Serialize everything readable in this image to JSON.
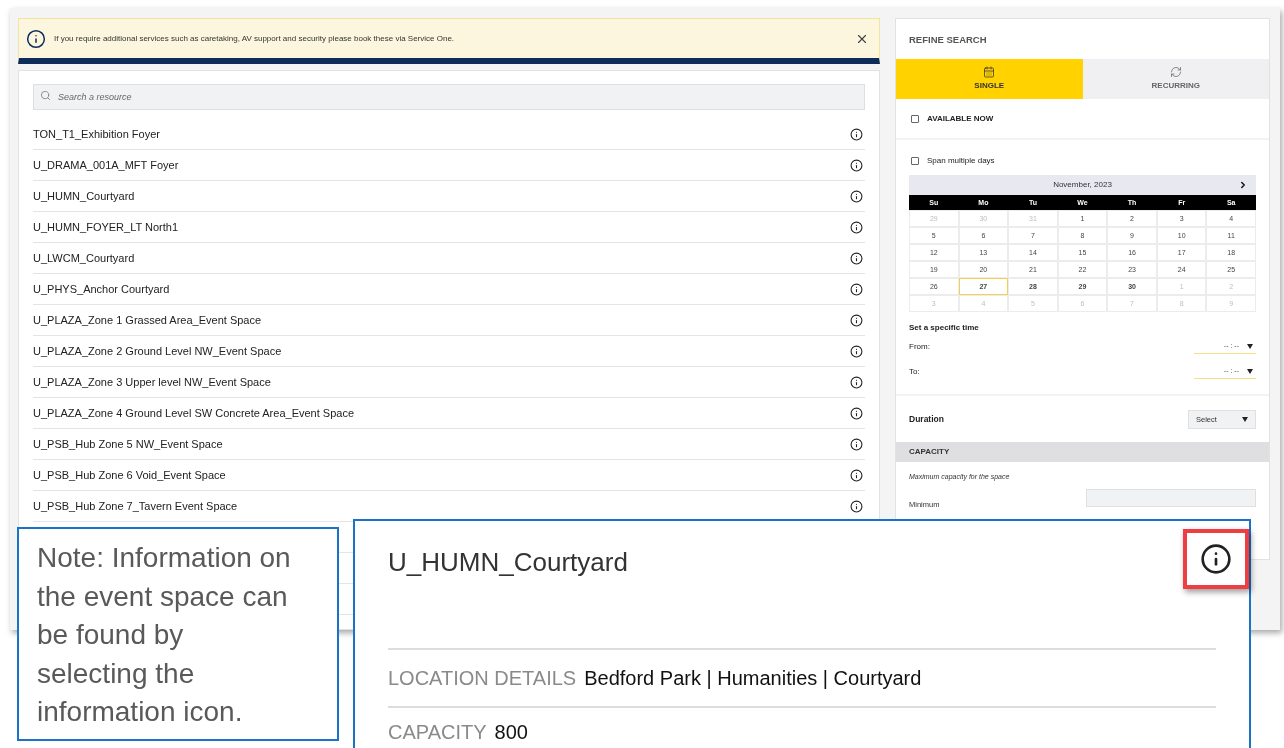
{
  "banner": {
    "message": "If you require additional services such as caretaking, AV support and security please book these via Service One."
  },
  "search": {
    "placeholder": "Search a resource"
  },
  "resources": [
    {
      "name": "TON_T1_Exhibition Foyer"
    },
    {
      "name": "U_DRAMA_001A_MFT Foyer"
    },
    {
      "name": "U_HUMN_Courtyard"
    },
    {
      "name": "U_HUMN_FOYER_LT North1"
    },
    {
      "name": "U_LWCM_Courtyard"
    },
    {
      "name": "U_PHYS_Anchor Courtyard"
    },
    {
      "name": "U_PLAZA_Zone 1 Grassed Area_Event Space"
    },
    {
      "name": "U_PLAZA_Zone 2 Ground Level NW_Event Space"
    },
    {
      "name": "U_PLAZA_Zone 3 Upper level NW_Event Space"
    },
    {
      "name": "U_PLAZA_Zone 4 Ground Level SW Concrete Area_Event Space"
    },
    {
      "name": "U_PSB_Hub Zone 5 NW_Event Space"
    },
    {
      "name": "U_PSB_Hub Zone 6 Void_Event Space"
    },
    {
      "name": "U_PSB_Hub Zone 7_Tavern Event Space"
    }
  ],
  "refine": {
    "title": "REFINE SEARCH",
    "tabs": [
      {
        "label": "SINGLE",
        "selected": true,
        "kind": "calendar"
      },
      {
        "label": "RECURRING",
        "selected": false,
        "kind": "recurring"
      }
    ],
    "available_now": {
      "label": "AVAILABLE NOW",
      "checked": false
    },
    "span_multiple_days": {
      "label": "Span multiple days",
      "checked": false
    },
    "calendar": {
      "month": "November, 2023",
      "weekdays": [
        "Su",
        "Mo",
        "Tu",
        "We",
        "Th",
        "Fr",
        "Sa"
      ],
      "weeks": [
        [
          {
            "d": "29",
            "muted": true,
            "bold": false,
            "selected": false
          },
          {
            "d": "30",
            "muted": true,
            "bold": false,
            "selected": false
          },
          {
            "d": "31",
            "muted": true,
            "bold": false,
            "selected": false
          },
          {
            "d": "1",
            "muted": false,
            "bold": false,
            "selected": false
          },
          {
            "d": "2",
            "muted": false,
            "bold": false,
            "selected": false
          },
          {
            "d": "3",
            "muted": false,
            "bold": false,
            "selected": false
          },
          {
            "d": "4",
            "muted": false,
            "bold": false,
            "selected": false
          }
        ],
        [
          {
            "d": "5",
            "muted": false,
            "bold": false,
            "selected": false
          },
          {
            "d": "6",
            "muted": false,
            "bold": false,
            "selected": false
          },
          {
            "d": "7",
            "muted": false,
            "bold": false,
            "selected": false
          },
          {
            "d": "8",
            "muted": false,
            "bold": false,
            "selected": false
          },
          {
            "d": "9",
            "muted": false,
            "bold": false,
            "selected": false
          },
          {
            "d": "10",
            "muted": false,
            "bold": false,
            "selected": false
          },
          {
            "d": "11",
            "muted": false,
            "bold": false,
            "selected": false
          }
        ],
        [
          {
            "d": "12",
            "muted": false,
            "bold": false,
            "selected": false
          },
          {
            "d": "13",
            "muted": false,
            "bold": false,
            "selected": false
          },
          {
            "d": "14",
            "muted": false,
            "bold": false,
            "selected": false
          },
          {
            "d": "15",
            "muted": false,
            "bold": false,
            "selected": false
          },
          {
            "d": "16",
            "muted": false,
            "bold": false,
            "selected": false
          },
          {
            "d": "17",
            "muted": false,
            "bold": false,
            "selected": false
          },
          {
            "d": "18",
            "muted": false,
            "bold": false,
            "selected": false
          }
        ],
        [
          {
            "d": "19",
            "muted": false,
            "bold": false,
            "selected": false
          },
          {
            "d": "20",
            "muted": false,
            "bold": false,
            "selected": false
          },
          {
            "d": "21",
            "muted": false,
            "bold": false,
            "selected": false
          },
          {
            "d": "22",
            "muted": false,
            "bold": false,
            "selected": false
          },
          {
            "d": "23",
            "muted": false,
            "bold": false,
            "selected": false
          },
          {
            "d": "24",
            "muted": false,
            "bold": false,
            "selected": false
          },
          {
            "d": "25",
            "muted": false,
            "bold": false,
            "selected": false
          }
        ],
        [
          {
            "d": "26",
            "muted": false,
            "bold": false,
            "selected": false
          },
          {
            "d": "27",
            "muted": false,
            "bold": true,
            "selected": true
          },
          {
            "d": "28",
            "muted": false,
            "bold": true,
            "selected": false
          },
          {
            "d": "29",
            "muted": false,
            "bold": true,
            "selected": false
          },
          {
            "d": "30",
            "muted": false,
            "bold": true,
            "selected": false
          },
          {
            "d": "1",
            "muted": true,
            "bold": false,
            "selected": false
          },
          {
            "d": "2",
            "muted": true,
            "bold": false,
            "selected": false
          }
        ],
        [
          {
            "d": "3",
            "muted": true,
            "bold": false,
            "selected": false
          },
          {
            "d": "4",
            "muted": true,
            "bold": false,
            "selected": false
          },
          {
            "d": "5",
            "muted": true,
            "bold": false,
            "selected": false
          },
          {
            "d": "6",
            "muted": true,
            "bold": false,
            "selected": false
          },
          {
            "d": "7",
            "muted": true,
            "bold": false,
            "selected": false
          },
          {
            "d": "8",
            "muted": true,
            "bold": false,
            "selected": false
          },
          {
            "d": "9",
            "muted": true,
            "bold": false,
            "selected": false
          }
        ]
      ]
    },
    "time": {
      "heading": "Set a specific time",
      "from": {
        "label": "From:",
        "value": "-- : --"
      },
      "to": {
        "label": "To:",
        "value": "-- : --"
      }
    },
    "duration": {
      "label": "Duration",
      "value": "Select"
    },
    "capacity": {
      "heading": "CAPACITY",
      "hint": "Maximum capacity for the space",
      "minimum_label": "Minimum"
    }
  },
  "note": {
    "text": "Note: Information on the event space can be found by selecting the information icon."
  },
  "detail_popup": {
    "title": "U_HUMN_Courtyard",
    "icon_highlighted": true,
    "location_label": "LOCATION DETAILS",
    "location": "Bedford Park | Humanities | Courtyard",
    "capacity_label": "CAPACITY",
    "capacity": "800"
  }
}
